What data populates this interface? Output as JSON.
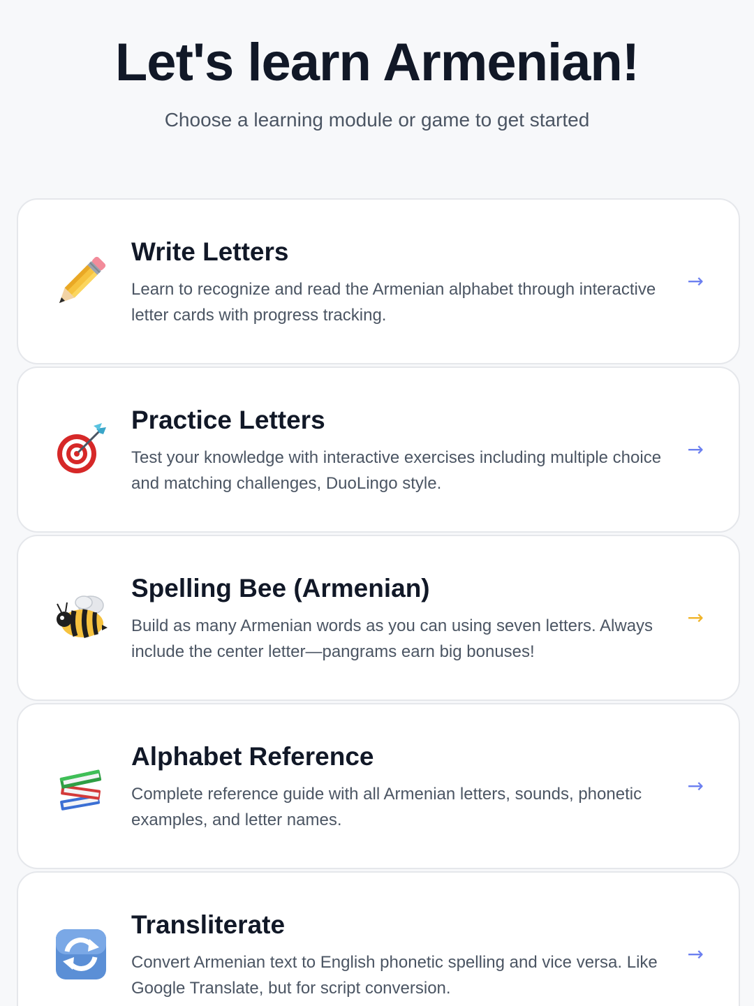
{
  "header": {
    "title": "Let's learn Armenian!",
    "subtitle": "Choose a learning module or game to get started"
  },
  "modules": [
    {
      "title": "Write Letters",
      "description": "Learn to recognize and read the Armenian alphabet through interactive letter cards with progress tracking.",
      "icon": "pencil-icon",
      "arrow": "→",
      "arrow_color": "#6b7ff0"
    },
    {
      "title": "Practice Letters",
      "description": "Test your knowledge with interactive exercises including multiple choice and matching challenges, DuoLingo style.",
      "icon": "target-dart-icon",
      "arrow": "→",
      "arrow_color": "#6b7ff0"
    },
    {
      "title": "Spelling Bee (Armenian)",
      "description": "Build as many Armenian words as you can using seven letters. Always include the center letter—pangrams earn big bonuses!",
      "icon": "bee-icon",
      "arrow": "→",
      "arrow_color": "#f0b429"
    },
    {
      "title": "Alphabet Reference",
      "description": "Complete reference guide with all Armenian letters, sounds, phonetic examples, and letter names.",
      "icon": "books-icon",
      "arrow": "→",
      "arrow_color": "#6b7ff0"
    },
    {
      "title": "Transliterate",
      "description": "Convert Armenian text to English phonetic spelling and vice versa. Like Google Translate, but for script conversion.",
      "icon": "refresh-icon",
      "arrow": "→",
      "arrow_color": "#6b7ff0"
    }
  ]
}
